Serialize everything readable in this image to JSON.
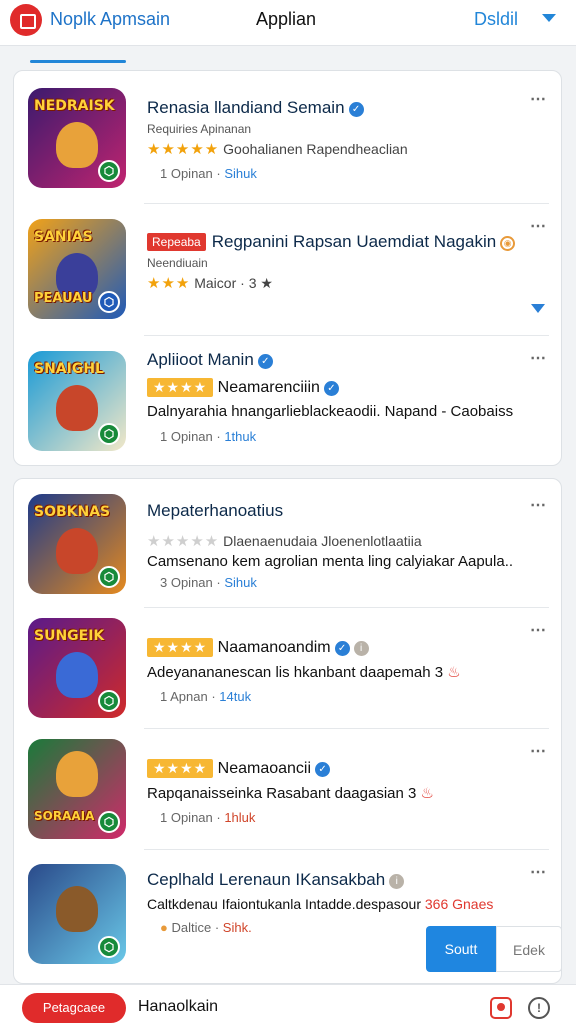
{
  "header": {
    "brand": "Noplk Apmsain",
    "title": "Applian",
    "right_menu": "Dsldil"
  },
  "apps": [
    {
      "thumb_text": "NEDRAISK",
      "title": "Renasia llandiand Semain",
      "subtitle": "Requiries Apinanan",
      "stars": "★★★★★",
      "rating_text": "Goohalianen Rapendheaclian",
      "meta_count": "1 Opinan",
      "meta_size": "Sihuk",
      "colors": {
        "bg1": "#3b1a6e",
        "bg2": "#c0246f",
        "hero": "#e8a23a"
      }
    },
    {
      "thumb_text": "SANIAS",
      "tag": "Repeaba",
      "title": "Regpanini Rapsan Uaemdiat Nagakin",
      "subtitle": "Neendiuain",
      "stars": "★★★",
      "rating_text": "Maicor",
      "rating_extra": "3 ★",
      "thumb_footer": "PEAUAU",
      "colors": {
        "bg1": "#f2a218",
        "bg2": "#1f5ab8",
        "hero": "#3a3f9a"
      }
    },
    {
      "thumb_text": "SNAIGHL",
      "title": "Apliioot Manin",
      "stars": "★★★★",
      "rating_text": "Neamarenciiin",
      "desc": "Dalnyarahia hnangarlieblackeaodii. Napand - Caobaiss",
      "meta_count": "1 Opinan",
      "meta_size": "1thuk",
      "colors": {
        "bg1": "#1a9ad6",
        "bg2": "#f2e8c8",
        "hero": "#c8462a"
      }
    },
    {
      "thumb_text": "SOBKNAS",
      "title": "Mepaterhanoatius",
      "stars": "★★★★★",
      "rating_text": "Dlaenaenudaia Jloenenlotlaatiia",
      "desc": "Camsenano kem agrolian menta ling calyiakar Aapula..",
      "meta_count": "3 Opinan",
      "meta_size": "Sihuk",
      "colors": {
        "bg1": "#1d3a8a",
        "bg2": "#e58a1f",
        "hero": "#c8462a"
      }
    },
    {
      "thumb_text": "SUNGEIK",
      "title": "",
      "stars": "★★★★",
      "rating_text": "Naamanoandim",
      "desc": "Adeyanananescan lis hkanbant daapemah",
      "desc_suffix": "3 ",
      "meta_count": "1 Apnan",
      "meta_size": "14tuk",
      "colors": {
        "bg1": "#5a1a8a",
        "bg2": "#d02a2a",
        "hero": "#3a6ad6"
      }
    },
    {
      "thumb_text": "SORAAIA",
      "title": "",
      "stars": "★★★★",
      "rating_text": "Neamaoancii",
      "desc": "Rapqanaisseinka Rasabant daagasian",
      "desc_suffix": "3 ",
      "meta_count": "1 Opinan",
      "meta_size": "1hluk",
      "colors": {
        "bg1": "#1a7a3a",
        "bg2": "#d02a6a",
        "hero": "#e8a23a"
      }
    },
    {
      "thumb_text": "",
      "title": "Ceplhald Lerenaun IKansakbah",
      "desc": "Caltkdenau Ifaiontukanla Intadde.despasour",
      "desc_suffix": "366 Gnaes",
      "meta_count": "Daltice",
      "meta_size": "Sihk.",
      "colors": {
        "bg1": "#2a4a8a",
        "bg2": "#6ac8e8",
        "hero": "#8a5a2a"
      }
    }
  ],
  "buttons": {
    "primary": "Soutt",
    "secondary": "Edek"
  },
  "bottom": {
    "pill": "Petagcaee",
    "label": "Hanaolkain"
  }
}
